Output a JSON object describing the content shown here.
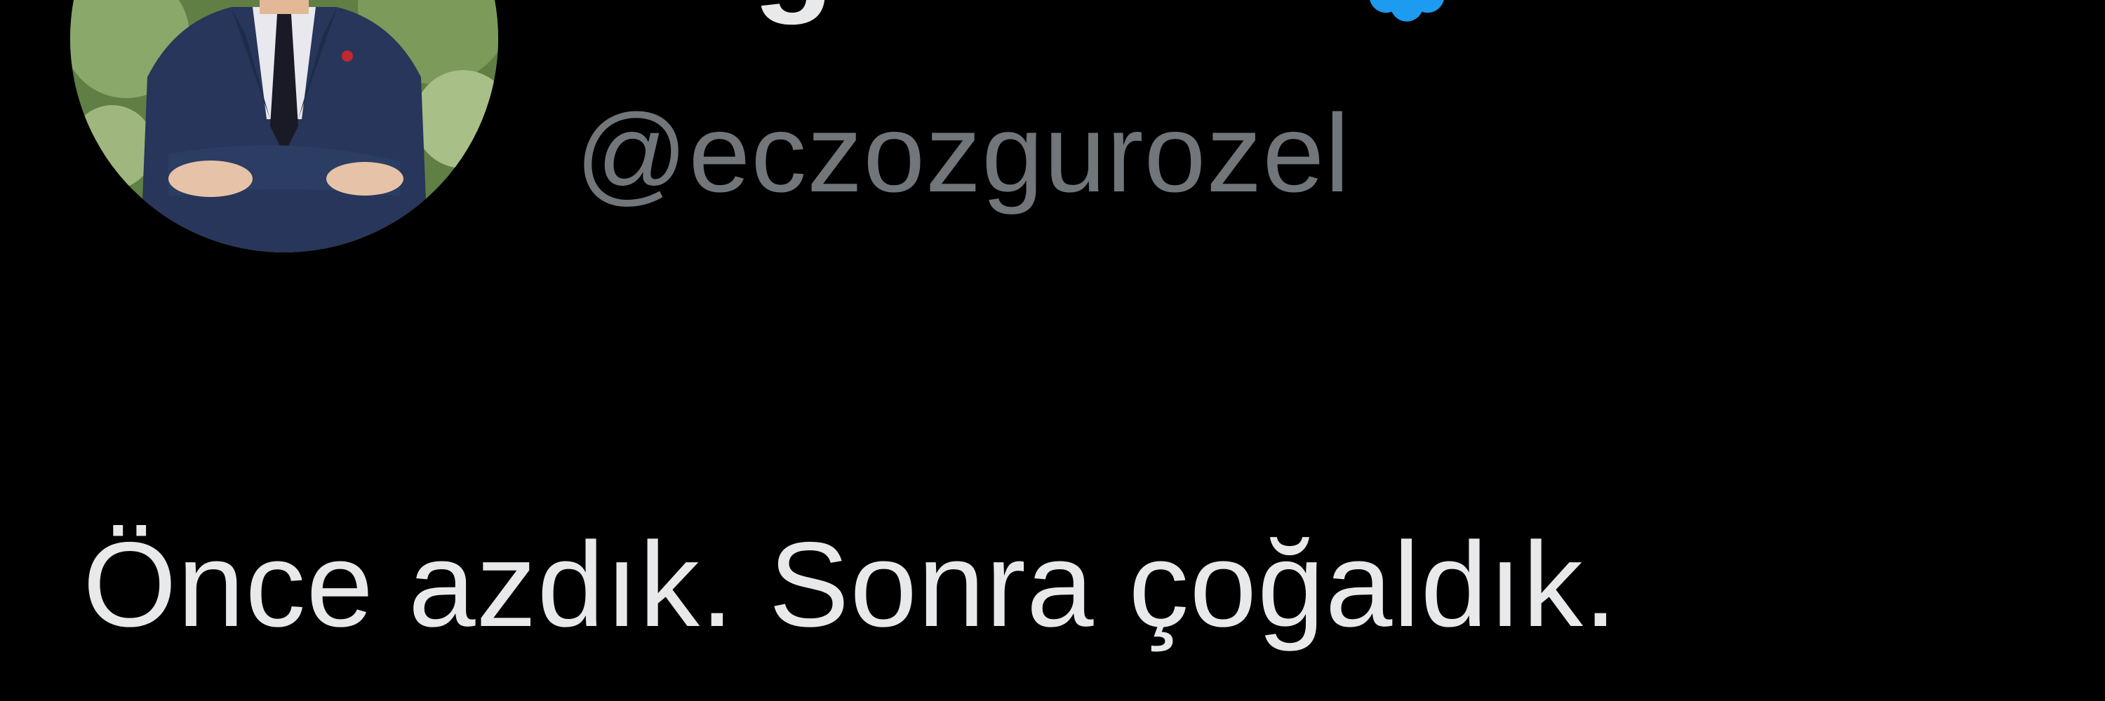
{
  "author": {
    "display_name": "Özgür Özel",
    "handle": "@eczozgurozel",
    "verified": true,
    "avatar_icon": "profile-photo"
  },
  "tweet": {
    "text": "Önce azdık. Sonra çoğaldık."
  },
  "colors": {
    "background": "#000000",
    "primary_text": "#e7e9ea",
    "secondary_text": "#71767b",
    "verified_badge": "#1d9bf0"
  }
}
